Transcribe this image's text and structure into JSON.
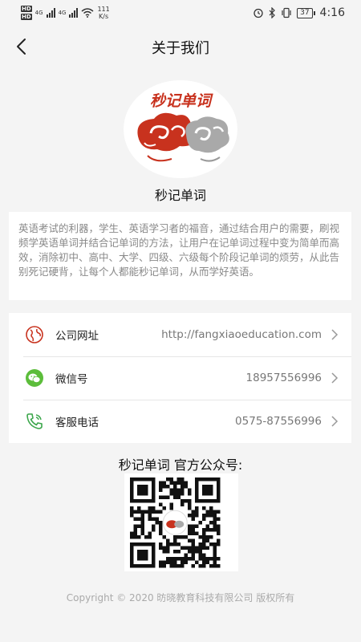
{
  "status_bar": {
    "hd1": "HD",
    "hd2": "HD",
    "net1": "4G",
    "net2": "4G",
    "speed_value": "111",
    "speed_unit": "K/s",
    "battery": "37",
    "time": "4:16"
  },
  "header": {
    "title": "关于我们"
  },
  "app": {
    "logo_text": "秒记单词",
    "name": "秒记单词"
  },
  "description": "英语考试的利器，学生、英语学习者的福音，通过结合用户的需要，刷视频学英语单词并结合记单词的方法，让用户在记单词过程中变为简单而高效，消除初中、高中、大学、四级、六级每个阶段记单词的烦劳，从此告别死记硬背，让每个人都能秒记单词，从而学好英语。",
  "contacts": [
    {
      "label": "公司网址",
      "value": "http://fangxiaoeducation.com",
      "icon": "globe-icon"
    },
    {
      "label": "微信号",
      "value": "18957556996",
      "icon": "wechat-icon"
    },
    {
      "label": "客服电话",
      "value": "0575-87556996",
      "icon": "phone-icon"
    }
  ],
  "official_account": {
    "title": "秒记单词 官方公众号:"
  },
  "footer": {
    "copyright": "Copyright © 2020 昉晓教育科技有限公司 版权所有"
  },
  "colors": {
    "accent_red": "#c8321e",
    "wechat_green": "#5cbd3b",
    "phone_green": "#3aa64a"
  }
}
